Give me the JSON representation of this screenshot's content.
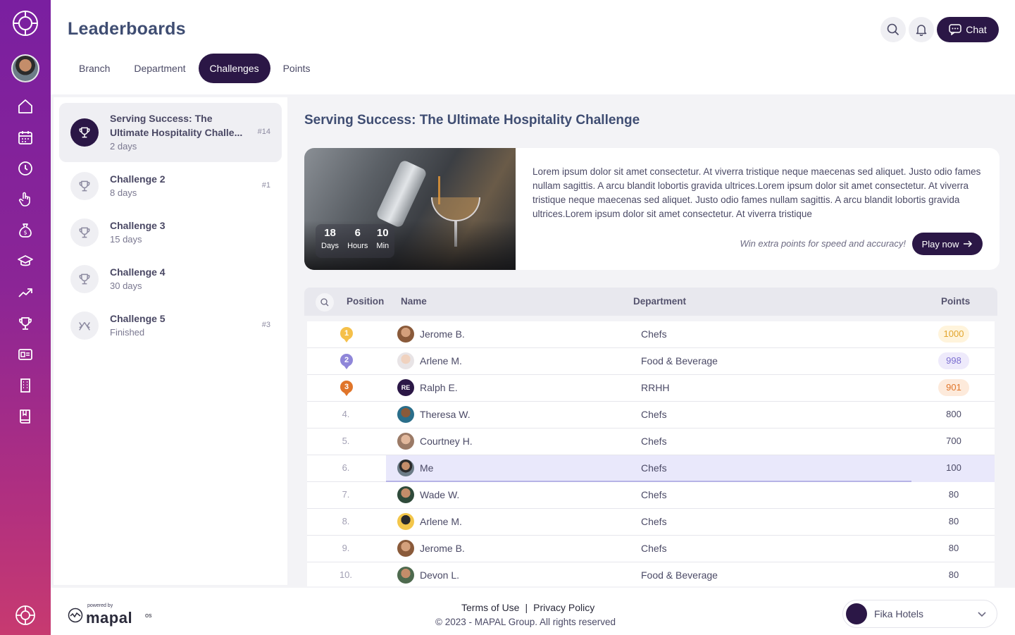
{
  "app": {
    "title": "Leaderboards"
  },
  "tabs": [
    {
      "label": "Branch"
    },
    {
      "label": "Department"
    },
    {
      "label": "Challenges",
      "active": true
    },
    {
      "label": "Points"
    }
  ],
  "header": {
    "chat_label": "Chat"
  },
  "challenges": [
    {
      "title": "Serving Success: The Ultimate Hospitality Challe...",
      "sub": "2 days",
      "rank": "#14",
      "active": true
    },
    {
      "title": "Challenge 2",
      "sub": "8 days",
      "rank": "#1"
    },
    {
      "title": "Challenge 3",
      "sub": "15 days",
      "rank": ""
    },
    {
      "title": "Challenge 4",
      "sub": "30 days",
      "rank": ""
    },
    {
      "title": "Challenge 5",
      "sub": "Finished",
      "rank": "#3"
    }
  ],
  "main": {
    "title": "Serving Success: The Ultimate Hospitality Challenge",
    "description": "Lorem ipsum dolor sit amet consectetur. At viverra tristique neque maecenas sed aliquet. Justo odio fames nullam sagittis. A arcu blandit lobortis gravida ultrices.Lorem ipsum dolor sit amet consectetur. At viverra tristique neque maecenas sed aliquet. Justo odio fames nullam sagittis. A arcu blandit lobortis gravida ultrices.Lorem ipsum dolor sit amet consectetur. At viverra tristique",
    "note": "Win extra points for speed and accuracy!",
    "play_label": "Play now",
    "timer": [
      {
        "value": "18",
        "label": "Days"
      },
      {
        "value": "6",
        "label": "Hours"
      },
      {
        "value": "10",
        "label": "Min"
      }
    ]
  },
  "table": {
    "headers": {
      "position": "Position",
      "name": "Name",
      "department": "Department",
      "points": "Points"
    },
    "rows": [
      {
        "pos": "1",
        "medal": "gold",
        "name": "Jerome B.",
        "dept": "Chefs",
        "points": "1000"
      },
      {
        "pos": "2",
        "medal": "silver",
        "name": "Arlene M.",
        "dept": "Food & Beverage",
        "points": "998"
      },
      {
        "pos": "3",
        "medal": "bronze",
        "name": "Ralph E.",
        "initials": "RE",
        "dept": "RRHH",
        "points": "901"
      },
      {
        "pos": "4.",
        "name": "Theresa W.",
        "dept": "Chefs",
        "points": "800"
      },
      {
        "pos": "5.",
        "name": "Courtney H.",
        "dept": "Chefs",
        "points": "700"
      },
      {
        "pos": "6.",
        "name": "Me",
        "dept": "Chefs",
        "points": "100",
        "me": true
      },
      {
        "pos": "7.",
        "name": "Wade W.",
        "dept": "Chefs",
        "points": "80"
      },
      {
        "pos": "8.",
        "name": "Arlene M.",
        "dept": "Chefs",
        "points": "80"
      },
      {
        "pos": "9.",
        "name": "Jerome B.",
        "dept": "Chefs",
        "points": "80"
      },
      {
        "pos": "10.",
        "name": "Devon L.",
        "dept": "Food & Beverage",
        "points": "80"
      }
    ]
  },
  "footer": {
    "powered_small": "powered by",
    "brand": "mapal",
    "brand_suffix": "os",
    "terms": "Terms of Use",
    "separator": "|",
    "privacy": "Privacy Policy",
    "copyright": "© 2023 - MAPAL Group. All rights reserved",
    "company": "Fika Hotels"
  },
  "colors": {
    "accent": "#2b1746",
    "gold": "#f5c04a",
    "silver": "#8f86d9",
    "bronze": "#e0752a",
    "gold_bg": "#fff4dc",
    "silver_bg": "#eeeafb",
    "bronze_bg": "#fdeadb"
  }
}
